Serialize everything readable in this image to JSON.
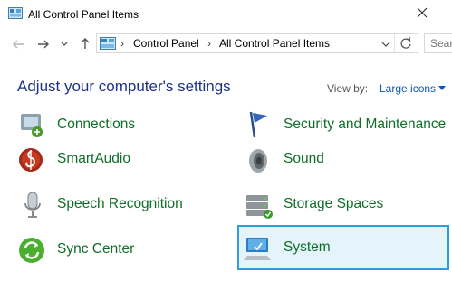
{
  "window": {
    "title": "All Control Panel Items"
  },
  "nav": {
    "breadcrumbs": [
      "Control Panel",
      "All Control Panel Items"
    ],
    "search_placeholder": "Sear"
  },
  "header": {
    "heading": "Adjust your computer's settings",
    "view_by_label": "View by:",
    "view_by_value": "Large icons"
  },
  "items": [
    {
      "label": "Connections",
      "icon": "connections-icon"
    },
    {
      "label": "Security and Maintenance",
      "icon": "flag-icon"
    },
    {
      "label": "SmartAudio",
      "icon": "smartaudio-icon"
    },
    {
      "label": "Sound",
      "icon": "speaker-icon"
    },
    {
      "label": "Speech Recognition",
      "icon": "microphone-icon"
    },
    {
      "label": "Storage Spaces",
      "icon": "storage-spaces-icon"
    },
    {
      "label": "Sync Center",
      "icon": "sync-center-icon"
    },
    {
      "label": "System",
      "icon": "system-icon",
      "selected": true
    }
  ],
  "colors": {
    "link_green": "#0f6e28",
    "heading_blue": "#1e3287",
    "selection": "#2c9fdb"
  }
}
